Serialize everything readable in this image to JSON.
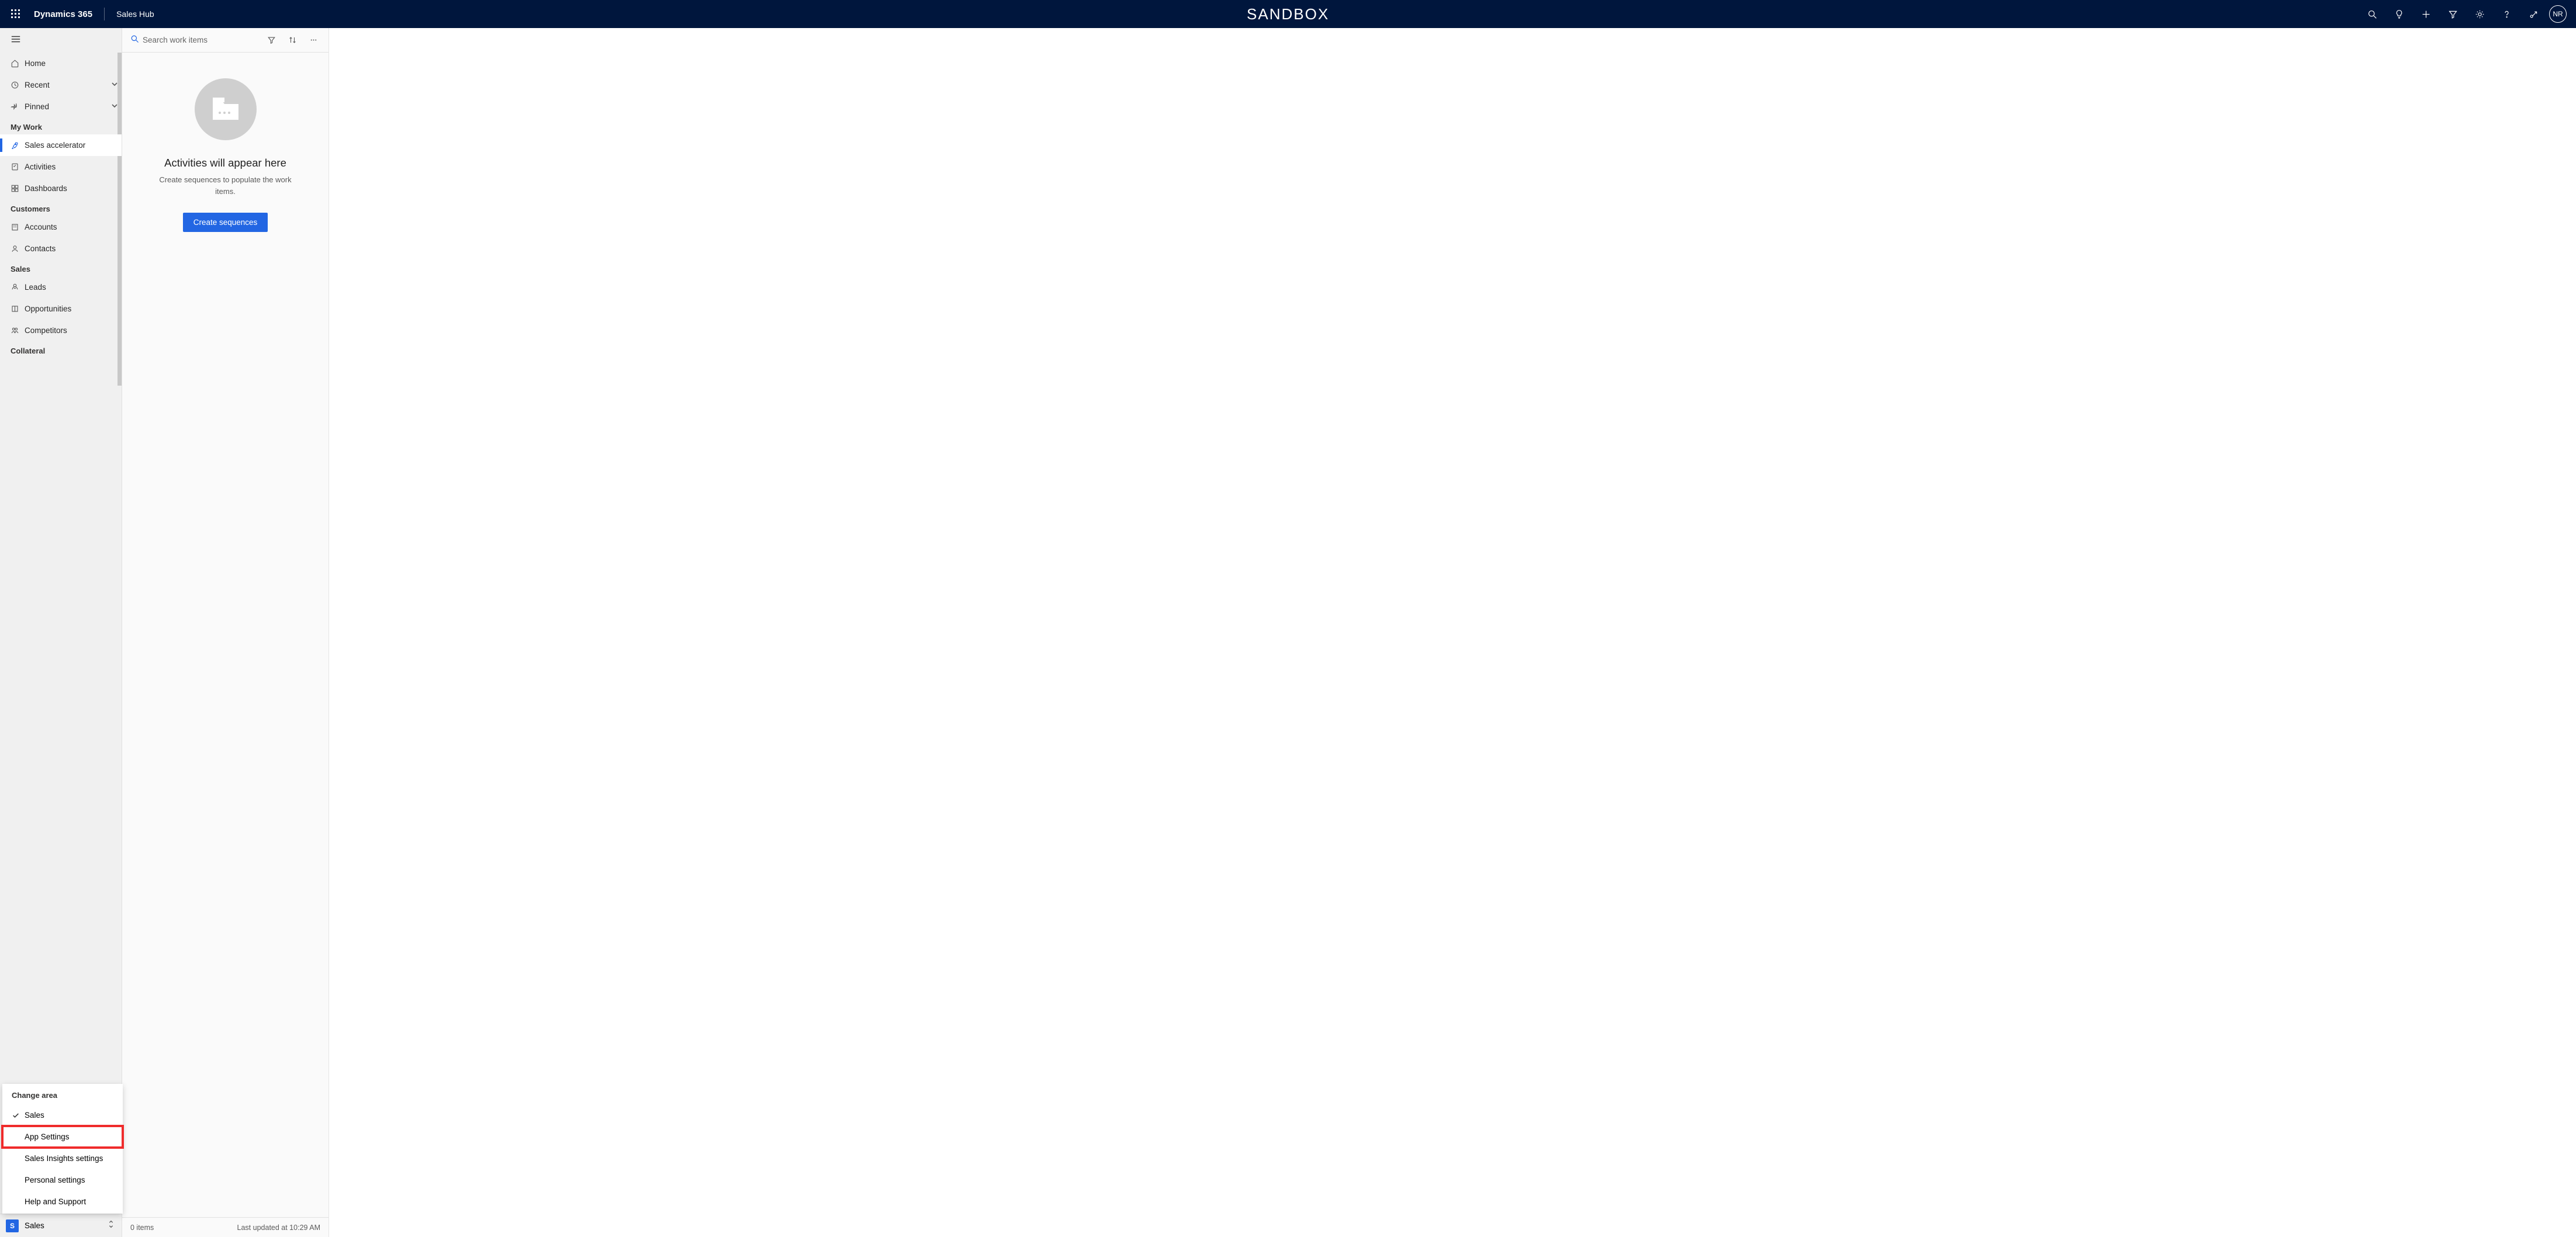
{
  "topbar": {
    "title": "Dynamics 365",
    "subtitle": "Sales Hub",
    "env_label": "SANDBOX",
    "avatar_initials": "NR"
  },
  "sidebar": {
    "home": "Home",
    "recent": "Recent",
    "pinned": "Pinned",
    "groups": {
      "mywork": "My Work",
      "customers": "Customers",
      "sales": "Sales",
      "collateral": "Collateral"
    },
    "items": {
      "sales_accelerator": "Sales accelerator",
      "activities": "Activities",
      "dashboards": "Dashboards",
      "accounts": "Accounts",
      "contacts": "Contacts",
      "leads": "Leads",
      "opportunities": "Opportunities",
      "competitors": "Competitors"
    }
  },
  "area_popup": {
    "header": "Change area",
    "sales": "Sales",
    "app_settings": "App Settings",
    "sales_insights": "Sales Insights settings",
    "personal": "Personal settings",
    "help": "Help and Support"
  },
  "area_switcher": {
    "badge": "S",
    "label": "Sales"
  },
  "worklist": {
    "search_placeholder": "Search work items",
    "empty_title": "Activities will appear here",
    "empty_sub": "Create sequences to populate the work items.",
    "cta": "Create sequences",
    "footer_left": "0 items",
    "footer_right": "Last updated at 10:29 AM"
  }
}
